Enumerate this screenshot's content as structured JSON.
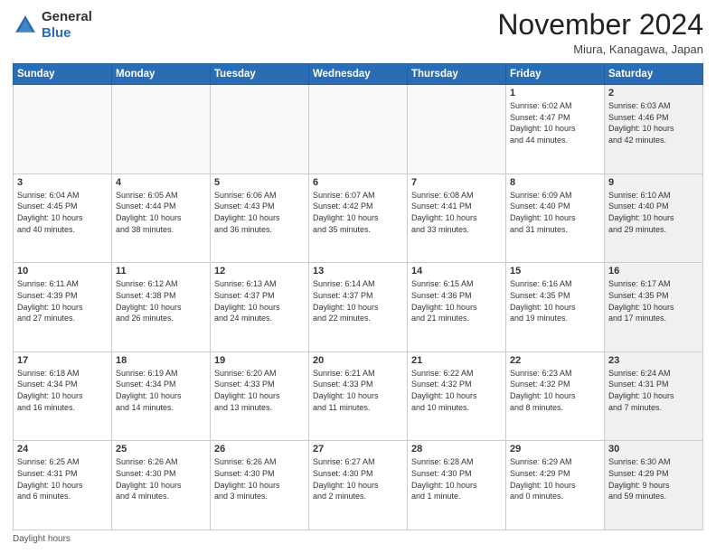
{
  "logo": {
    "general": "General",
    "blue": "Blue"
  },
  "header": {
    "month": "November 2024",
    "location": "Miura, Kanagawa, Japan"
  },
  "days_of_week": [
    "Sunday",
    "Monday",
    "Tuesday",
    "Wednesday",
    "Thursday",
    "Friday",
    "Saturday"
  ],
  "footer": {
    "label": "Daylight hours"
  },
  "weeks": [
    [
      {
        "day": "",
        "info": "",
        "empty": true
      },
      {
        "day": "",
        "info": "",
        "empty": true
      },
      {
        "day": "",
        "info": "",
        "empty": true
      },
      {
        "day": "",
        "info": "",
        "empty": true
      },
      {
        "day": "",
        "info": "",
        "empty": true
      },
      {
        "day": "1",
        "info": "Sunrise: 6:02 AM\nSunset: 4:47 PM\nDaylight: 10 hours\nand 44 minutes.",
        "empty": false,
        "shaded": false
      },
      {
        "day": "2",
        "info": "Sunrise: 6:03 AM\nSunset: 4:46 PM\nDaylight: 10 hours\nand 42 minutes.",
        "empty": false,
        "shaded": true
      }
    ],
    [
      {
        "day": "3",
        "info": "Sunrise: 6:04 AM\nSunset: 4:45 PM\nDaylight: 10 hours\nand 40 minutes.",
        "shaded": false
      },
      {
        "day": "4",
        "info": "Sunrise: 6:05 AM\nSunset: 4:44 PM\nDaylight: 10 hours\nand 38 minutes.",
        "shaded": false
      },
      {
        "day": "5",
        "info": "Sunrise: 6:06 AM\nSunset: 4:43 PM\nDaylight: 10 hours\nand 36 minutes.",
        "shaded": false
      },
      {
        "day": "6",
        "info": "Sunrise: 6:07 AM\nSunset: 4:42 PM\nDaylight: 10 hours\nand 35 minutes.",
        "shaded": false
      },
      {
        "day": "7",
        "info": "Sunrise: 6:08 AM\nSunset: 4:41 PM\nDaylight: 10 hours\nand 33 minutes.",
        "shaded": false
      },
      {
        "day": "8",
        "info": "Sunrise: 6:09 AM\nSunset: 4:40 PM\nDaylight: 10 hours\nand 31 minutes.",
        "shaded": false
      },
      {
        "day": "9",
        "info": "Sunrise: 6:10 AM\nSunset: 4:40 PM\nDaylight: 10 hours\nand 29 minutes.",
        "shaded": true
      }
    ],
    [
      {
        "day": "10",
        "info": "Sunrise: 6:11 AM\nSunset: 4:39 PM\nDaylight: 10 hours\nand 27 minutes.",
        "shaded": false
      },
      {
        "day": "11",
        "info": "Sunrise: 6:12 AM\nSunset: 4:38 PM\nDaylight: 10 hours\nand 26 minutes.",
        "shaded": false
      },
      {
        "day": "12",
        "info": "Sunrise: 6:13 AM\nSunset: 4:37 PM\nDaylight: 10 hours\nand 24 minutes.",
        "shaded": false
      },
      {
        "day": "13",
        "info": "Sunrise: 6:14 AM\nSunset: 4:37 PM\nDaylight: 10 hours\nand 22 minutes.",
        "shaded": false
      },
      {
        "day": "14",
        "info": "Sunrise: 6:15 AM\nSunset: 4:36 PM\nDaylight: 10 hours\nand 21 minutes.",
        "shaded": false
      },
      {
        "day": "15",
        "info": "Sunrise: 6:16 AM\nSunset: 4:35 PM\nDaylight: 10 hours\nand 19 minutes.",
        "shaded": false
      },
      {
        "day": "16",
        "info": "Sunrise: 6:17 AM\nSunset: 4:35 PM\nDaylight: 10 hours\nand 17 minutes.",
        "shaded": true
      }
    ],
    [
      {
        "day": "17",
        "info": "Sunrise: 6:18 AM\nSunset: 4:34 PM\nDaylight: 10 hours\nand 16 minutes.",
        "shaded": false
      },
      {
        "day": "18",
        "info": "Sunrise: 6:19 AM\nSunset: 4:34 PM\nDaylight: 10 hours\nand 14 minutes.",
        "shaded": false
      },
      {
        "day": "19",
        "info": "Sunrise: 6:20 AM\nSunset: 4:33 PM\nDaylight: 10 hours\nand 13 minutes.",
        "shaded": false
      },
      {
        "day": "20",
        "info": "Sunrise: 6:21 AM\nSunset: 4:33 PM\nDaylight: 10 hours\nand 11 minutes.",
        "shaded": false
      },
      {
        "day": "21",
        "info": "Sunrise: 6:22 AM\nSunset: 4:32 PM\nDaylight: 10 hours\nand 10 minutes.",
        "shaded": false
      },
      {
        "day": "22",
        "info": "Sunrise: 6:23 AM\nSunset: 4:32 PM\nDaylight: 10 hours\nand 8 minutes.",
        "shaded": false
      },
      {
        "day": "23",
        "info": "Sunrise: 6:24 AM\nSunset: 4:31 PM\nDaylight: 10 hours\nand 7 minutes.",
        "shaded": true
      }
    ],
    [
      {
        "day": "24",
        "info": "Sunrise: 6:25 AM\nSunset: 4:31 PM\nDaylight: 10 hours\nand 6 minutes.",
        "shaded": false
      },
      {
        "day": "25",
        "info": "Sunrise: 6:26 AM\nSunset: 4:30 PM\nDaylight: 10 hours\nand 4 minutes.",
        "shaded": false
      },
      {
        "day": "26",
        "info": "Sunrise: 6:26 AM\nSunset: 4:30 PM\nDaylight: 10 hours\nand 3 minutes.",
        "shaded": false
      },
      {
        "day": "27",
        "info": "Sunrise: 6:27 AM\nSunset: 4:30 PM\nDaylight: 10 hours\nand 2 minutes.",
        "shaded": false
      },
      {
        "day": "28",
        "info": "Sunrise: 6:28 AM\nSunset: 4:30 PM\nDaylight: 10 hours\nand 1 minute.",
        "shaded": false
      },
      {
        "day": "29",
        "info": "Sunrise: 6:29 AM\nSunset: 4:29 PM\nDaylight: 10 hours\nand 0 minutes.",
        "shaded": false
      },
      {
        "day": "30",
        "info": "Sunrise: 6:30 AM\nSunset: 4:29 PM\nDaylight: 9 hours\nand 59 minutes.",
        "shaded": true
      }
    ]
  ]
}
